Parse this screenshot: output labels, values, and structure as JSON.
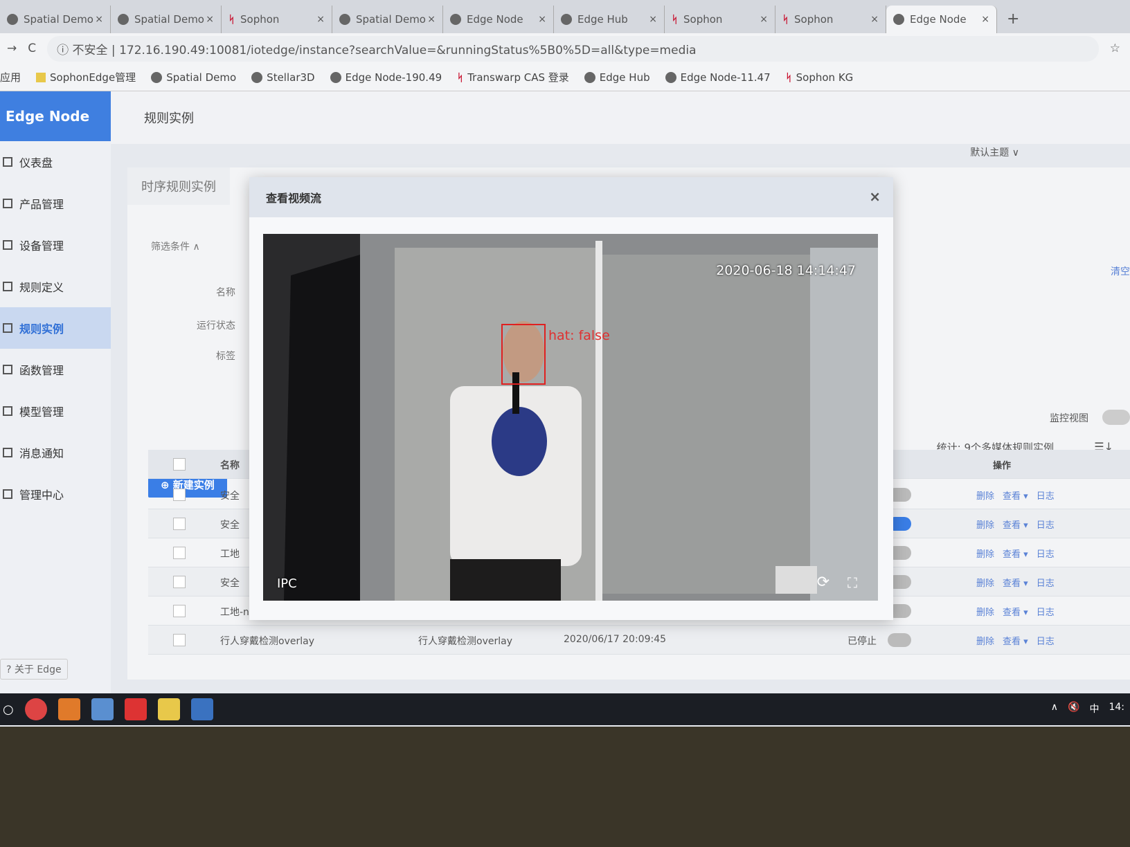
{
  "browser": {
    "tabs": [
      {
        "label": "Spatial Demo",
        "icon": "globe"
      },
      {
        "label": "Spatial Demo",
        "icon": "globe"
      },
      {
        "label": "Sophon",
        "icon": "sophon"
      },
      {
        "label": "Spatial Demo",
        "icon": "globe"
      },
      {
        "label": "Edge Node",
        "icon": "edge"
      },
      {
        "label": "Edge Hub",
        "icon": "edge"
      },
      {
        "label": "Sophon",
        "icon": "sophon"
      },
      {
        "label": "Sophon",
        "icon": "sophon"
      },
      {
        "label": "Edge Node",
        "icon": "edge",
        "active": true
      }
    ],
    "insecure": "不安全",
    "url": "172.16.190.49:10081/iotedge/instance?searchValue=&runningStatus%5B0%5D=all&type=media",
    "bookmarks": [
      "应用",
      "SophonEdge管理",
      "Spatial Demo",
      "Stellar3D",
      "Edge Node-190.49",
      "Transwarp CAS 登录",
      "Edge Hub",
      "Edge Node-11.47",
      "Sophon KG"
    ]
  },
  "sidebar": {
    "brand": "Edge Node",
    "items": [
      "仪表盘",
      "产品管理",
      "设备管理",
      "规则定义",
      "规则实例",
      "函数管理",
      "模型管理",
      "消息通知",
      "管理中心"
    ],
    "active": "规则实例",
    "about": "关于 Edge"
  },
  "header": {
    "title": "规则实例",
    "theme": "默认主题"
  },
  "page": {
    "tab": "时序规则实例",
    "filter": "筛选条件",
    "filter_fields": [
      "名称",
      "运行状态",
      "标签"
    ],
    "clear": "清空",
    "new_button": "新建实例",
    "monitor_view": "监控视图",
    "stats": "统计: 9个多媒体规则实例",
    "columns": {
      "name": "名称",
      "actions": "操作"
    },
    "actions": [
      "删除",
      "查看 ▾",
      "日志"
    ],
    "rows": [
      {
        "name": "安全",
        "type": "",
        "time": "",
        "status": "",
        "on": false
      },
      {
        "name": "安全",
        "type": "",
        "time": "",
        "status": "",
        "on": true
      },
      {
        "name": "工地",
        "type": "",
        "time": "",
        "status": "",
        "on": false
      },
      {
        "name": "安全",
        "type": "",
        "time": "",
        "status": "",
        "on": false
      },
      {
        "name": "工地-new",
        "type": "",
        "time": "",
        "status": "",
        "on": false
      },
      {
        "name": "行人穿戴检测overlay",
        "type": "行人穿戴检测overlay",
        "time": "2020/06/17 20:09:45",
        "status": "已停止",
        "on": false
      }
    ]
  },
  "modal": {
    "title": "查看视频流",
    "timestamp": "2020-06-18 14:14:47",
    "detection": "hat: false",
    "camera": "IPC"
  },
  "taskbar": {
    "ime": "中",
    "clock": "14:"
  },
  "colors": {
    "accent": "#3a7ee6",
    "detection": "#e02020"
  }
}
